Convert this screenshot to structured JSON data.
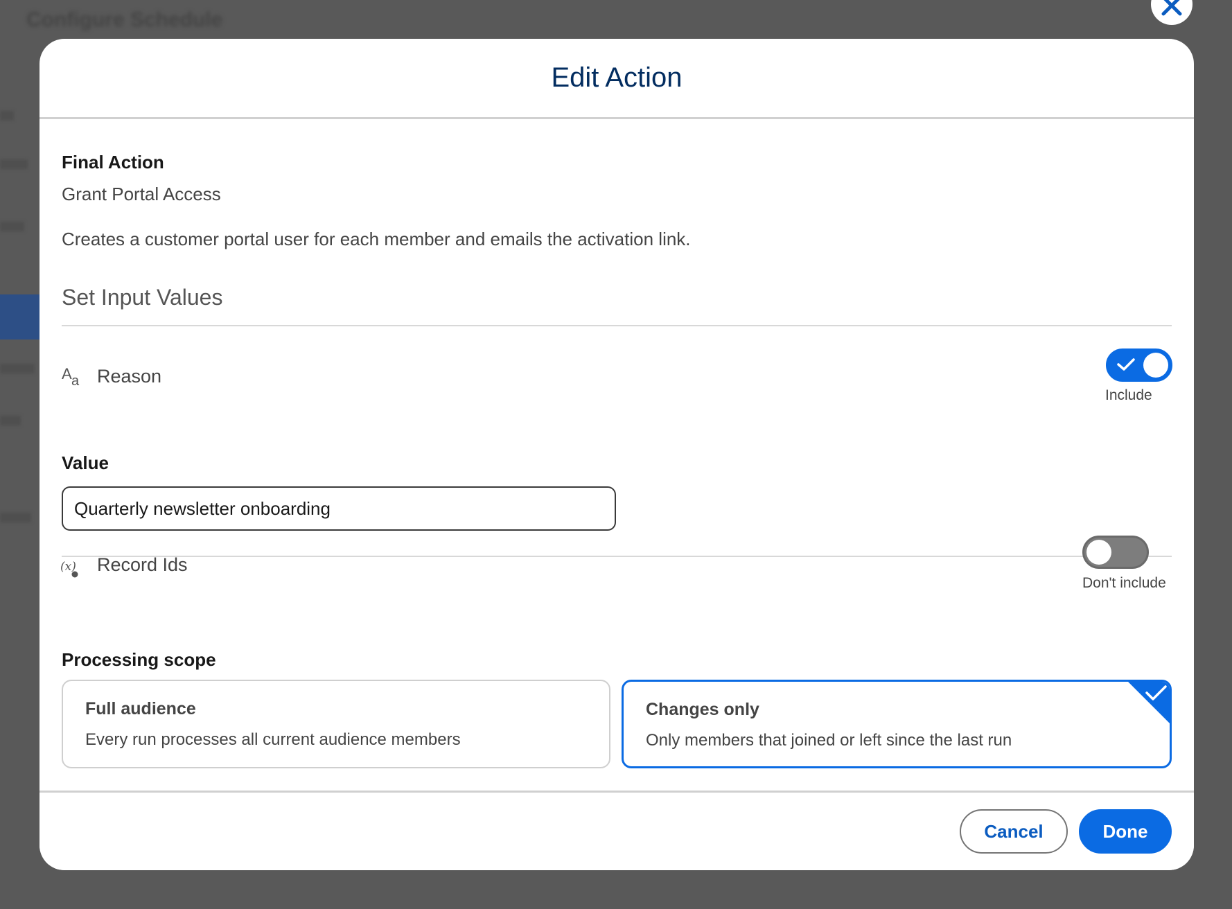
{
  "background": {
    "title": "Configure Schedule"
  },
  "modal": {
    "title": "Edit Action",
    "final_action_label": "Final Action",
    "final_action_name": "Grant Portal Access",
    "final_action_description": "Creates a customer portal user for each member and emails the activation link.",
    "section_title": "Set Input Values",
    "inputs": [
      {
        "icon": "text-type-icon",
        "icon_glyph": "Aa",
        "label": "Reason",
        "toggle_on": true,
        "toggle_caption": "Include",
        "value_label": "Value",
        "value": "Quarterly newsletter onboarding"
      },
      {
        "icon": "variable-icon",
        "icon_glyph": "(x)",
        "label": "Record Ids",
        "toggle_on": false,
        "toggle_caption": "Don't include"
      }
    ],
    "processing_scope": {
      "label": "Processing scope",
      "options": [
        {
          "title": "Full audience",
          "description": "Every run processes all current audience members",
          "selected": false
        },
        {
          "title": "Changes only",
          "description": "Only members that joined or left since the last run",
          "selected": true
        }
      ]
    },
    "footer": {
      "cancel_label": "Cancel",
      "done_label": "Done"
    }
  },
  "colors": {
    "brand_blue": "#0b6be3",
    "title_navy": "#032d60",
    "overlay": "#5c5c5c"
  }
}
